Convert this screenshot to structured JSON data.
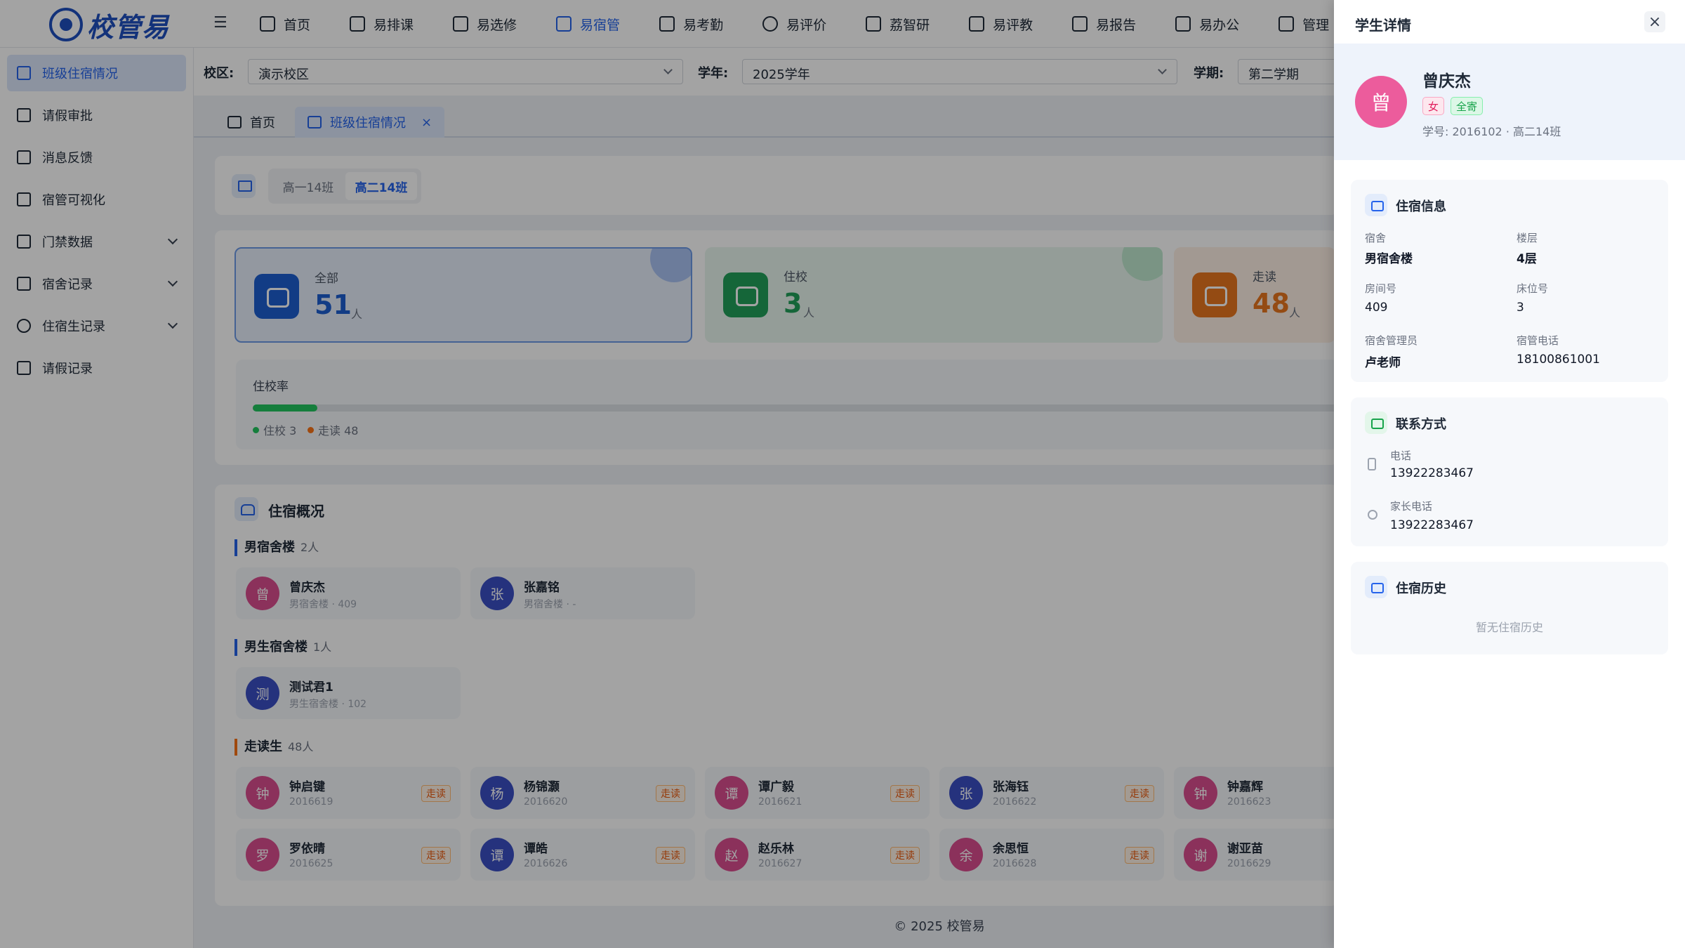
{
  "brand": {
    "name": "校管易"
  },
  "nav": [
    {
      "label": "首页",
      "icon": "monitor-icon"
    },
    {
      "label": "易排课",
      "icon": "calendar-icon"
    },
    {
      "label": "易选修",
      "icon": "book-icon"
    },
    {
      "label": "易宿管",
      "icon": "dorm-icon",
      "active": true
    },
    {
      "label": "易考勤",
      "icon": "calendar-check-icon"
    },
    {
      "label": "易评价",
      "icon": "star-icon"
    },
    {
      "label": "荔智研",
      "icon": "research-icon"
    },
    {
      "label": "易评教",
      "icon": "graduation-cap-icon"
    },
    {
      "label": "易报告",
      "icon": "report-icon"
    },
    {
      "label": "易办公",
      "icon": "briefcase-icon"
    },
    {
      "label": "管理",
      "icon": "gear-icon"
    }
  ],
  "sidebar": {
    "items": [
      {
        "label": "班级住宿情况",
        "icon": "users-icon",
        "active": true
      },
      {
        "label": "请假审批",
        "icon": "document-icon"
      },
      {
        "label": "消息反馈",
        "icon": "message-icon"
      },
      {
        "label": "宿管可视化",
        "icon": "chart-icon"
      },
      {
        "label": "门禁数据",
        "icon": "gate-icon",
        "expandable": true
      },
      {
        "label": "宿舍记录",
        "icon": "home-icon",
        "expandable": true
      },
      {
        "label": "住宿生记录",
        "icon": "user-icon",
        "expandable": true
      },
      {
        "label": "请假记录",
        "icon": "calendar-icon"
      }
    ]
  },
  "filters": {
    "campus_label": "校区:",
    "campus_value": "演示校区",
    "year_label": "学年:",
    "year_value": "2025学年",
    "term_label": "学期:",
    "term_value": "第二学期"
  },
  "page_tabs": [
    {
      "label": "首页"
    },
    {
      "label": "班级住宿情况",
      "active": true,
      "close": "×"
    }
  ],
  "class_tabs": [
    {
      "label": "高一14班"
    },
    {
      "label": "高二14班",
      "active": true
    }
  ],
  "stats": [
    {
      "label": "全部",
      "value": "51",
      "unit": "人",
      "color": "#1d5fd1"
    },
    {
      "label": "住校",
      "value": "3",
      "unit": "人",
      "color": "#22a05a"
    },
    {
      "label": "走读",
      "value": "48",
      "unit": "人",
      "color": "#e8761f"
    }
  ],
  "rate": {
    "label": "住校率",
    "fraction": 0.059,
    "legend_boarding": "住校 3",
    "legend_day": "走读 48"
  },
  "overview": {
    "title": "住宿概况",
    "groups": [
      {
        "name": "男宿舍楼",
        "count": "2人"
      },
      {
        "name": "男生宿舍楼",
        "count": "1人"
      },
      {
        "name": "走读生",
        "count": "48人"
      }
    ],
    "boarders": [
      {
        "avatar": "曾",
        "name": "曾庆杰",
        "sub": "男宿舍楼 · 409",
        "color": "#d94d8f"
      },
      {
        "avatar": "张",
        "name": "张嘉铭",
        "sub": "男宿舍楼 · -",
        "color": "#3b4fc4"
      },
      {
        "avatar": "测",
        "name": "测试君1",
        "sub": "男生宿舍楼 · 102",
        "color": "#3b4fc4"
      }
    ],
    "day_students": [
      {
        "avatar": "钟",
        "name": "钟启键",
        "sub": "2016619",
        "tag": "走读",
        "color": "#d94d8f"
      },
      {
        "avatar": "杨",
        "name": "杨锦灏",
        "sub": "2016620",
        "tag": "走读",
        "color": "#3b4fc4"
      },
      {
        "avatar": "谭",
        "name": "谭广毅",
        "sub": "2016621",
        "tag": "走读",
        "color": "#d94d8f"
      },
      {
        "avatar": "张",
        "name": "张海钰",
        "sub": "2016622",
        "tag": "走读",
        "color": "#3b4fc4"
      },
      {
        "avatar": "钟",
        "name": "钟嘉辉",
        "sub": "2016623",
        "tag": "",
        "color": "#d94d8f"
      },
      {
        "avatar": "罗",
        "name": "罗依晴",
        "sub": "2016625",
        "tag": "走读",
        "color": "#d94d8f"
      },
      {
        "avatar": "谭",
        "name": "谭皓",
        "sub": "2016626",
        "tag": "走读",
        "color": "#3b4fc4"
      },
      {
        "avatar": "赵",
        "name": "赵乐林",
        "sub": "2016627",
        "tag": "走读",
        "color": "#d94d8f"
      },
      {
        "avatar": "余",
        "name": "余思恒",
        "sub": "2016628",
        "tag": "走读",
        "color": "#d94d8f"
      },
      {
        "avatar": "谢",
        "name": "谢亚苗",
        "sub": "2016629",
        "tag": "",
        "color": "#d94d8f"
      }
    ]
  },
  "footer": "© 2025 校管易",
  "drawer": {
    "title": "学生详情",
    "close": "×",
    "avatar": "曾",
    "name": "曾庆杰",
    "gender_tag": "女",
    "type_tag": "全寄",
    "sub": "学号: 2016102 · 高二14班",
    "dorm_info": {
      "title": "住宿信息",
      "fields": [
        {
          "key": "宿舍",
          "value": "男宿舍楼"
        },
        {
          "key": "楼层",
          "value": "4层"
        },
        {
          "key": "房间号",
          "value": "409"
        },
        {
          "key": "床位号",
          "value": "3"
        },
        {
          "key": "宿舍管理员",
          "value": "卢老师"
        },
        {
          "key": "宿管电话",
          "value": "18100861001"
        }
      ]
    },
    "contact": {
      "title": "联系方式",
      "phone_label": "电话",
      "phone": "13922283467",
      "parent_label": "家长电话",
      "parent_phone": "13922283467"
    },
    "history": {
      "title": "住宿历史",
      "empty": "暂无住宿历史"
    }
  }
}
